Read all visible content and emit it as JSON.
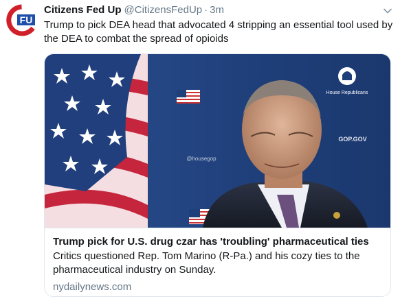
{
  "tweet": {
    "display_name": "Citizens Fed Up",
    "handle": "@CitizensFedUp",
    "separator": "·",
    "time": "3m",
    "text": "Trump to pick DEA head that advocated 4 stripping an essential tool used by the DEA to combat the spread of opioids",
    "avatar_text": "FU"
  },
  "card": {
    "title": "Trump pick for U.S. drug czar has 'troubling' pharmaceutical ties",
    "description": "Critics questioned Rep. Tom Marino (R-Pa.) and his cozy ties to the pharmaceutical industry on Sunday.",
    "domain": "nydailynews.com",
    "image_text": {
      "backdrop_logo": "House Republicans",
      "backdrop_url": "GOP.GOV",
      "backdrop_handle": "@housegop"
    }
  },
  "icons": {
    "menu": "chevron-down-icon",
    "avatar": "citizens-fed-up-logo"
  },
  "colors": {
    "text_primary": "#14171a",
    "text_secondary": "#657786",
    "card_border": "#e1e8ed",
    "avatar_red": "#d0202a",
    "avatar_blue": "#1d4ea8",
    "backdrop_navy": "#1f3f7a"
  }
}
